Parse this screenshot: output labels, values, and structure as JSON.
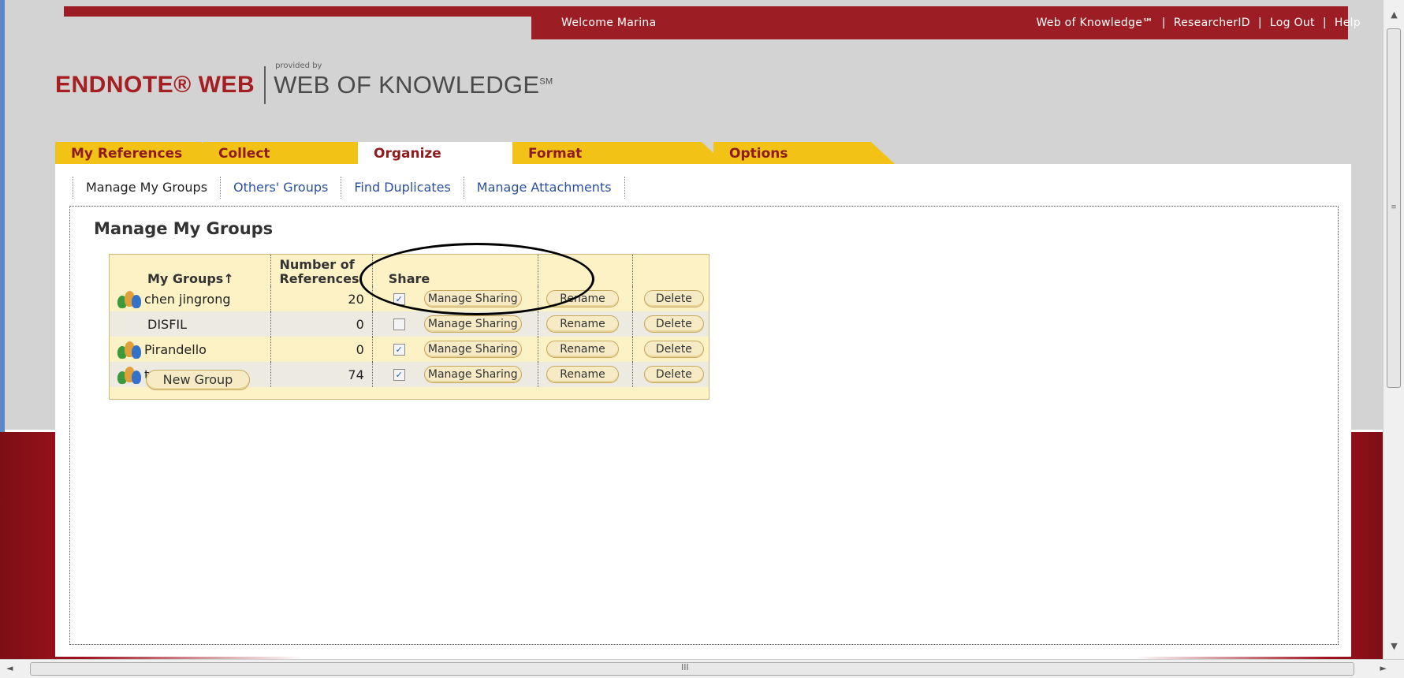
{
  "header": {
    "welcome": "Welcome Marina",
    "links": [
      "Web of Knowledge℠",
      "ResearcherID",
      "Log Out",
      "Help"
    ],
    "separator": "|"
  },
  "logo": {
    "endnote": "ENDNOTE® WEB",
    "provided_by": "provided by",
    "wok": "WEB OF KNOWLEDGE",
    "sm": "SM"
  },
  "tabs": [
    {
      "label": "My References"
    },
    {
      "label": "Collect"
    },
    {
      "label": "Organize"
    },
    {
      "label": "Format"
    },
    {
      "label": "Options"
    }
  ],
  "active_tab": "Organize",
  "subnav": [
    "Manage My Groups",
    "Others' Groups",
    "Find Duplicates",
    "Manage Attachments"
  ],
  "panel": {
    "title": "Manage My Groups"
  },
  "groups_table": {
    "headers": {
      "name": "My Groups",
      "sort_arrow": "↑",
      "number": "Number of References",
      "share": "Share"
    },
    "rows": [
      {
        "name": "chen jingrong",
        "count": "20",
        "shared": true,
        "has_icon": true
      },
      {
        "name": "DISFIL",
        "count": "0",
        "shared": false,
        "has_icon": false
      },
      {
        "name": "Pirandello",
        "count": "0",
        "shared": true,
        "has_icon": true
      },
      {
        "name": "test",
        "count": "74",
        "shared": true,
        "has_icon": true
      }
    ],
    "buttons": {
      "manage_sharing": "Manage Sharing",
      "rename": "Rename",
      "delete": "Delete",
      "new_group": "New Group"
    },
    "check_glyph": "✓"
  },
  "scrollbars": {
    "up": "▲",
    "down": "▼",
    "left": "◄",
    "right": "►",
    "v_grip": "≡",
    "h_grip": "III"
  },
  "colors": {
    "brand_red": "#9c1e24",
    "tab_yellow": "#f2c217",
    "tab_text": "#8e1b1e",
    "link_blue": "#2b4fa0",
    "table_bg": "#fdf1c6"
  }
}
